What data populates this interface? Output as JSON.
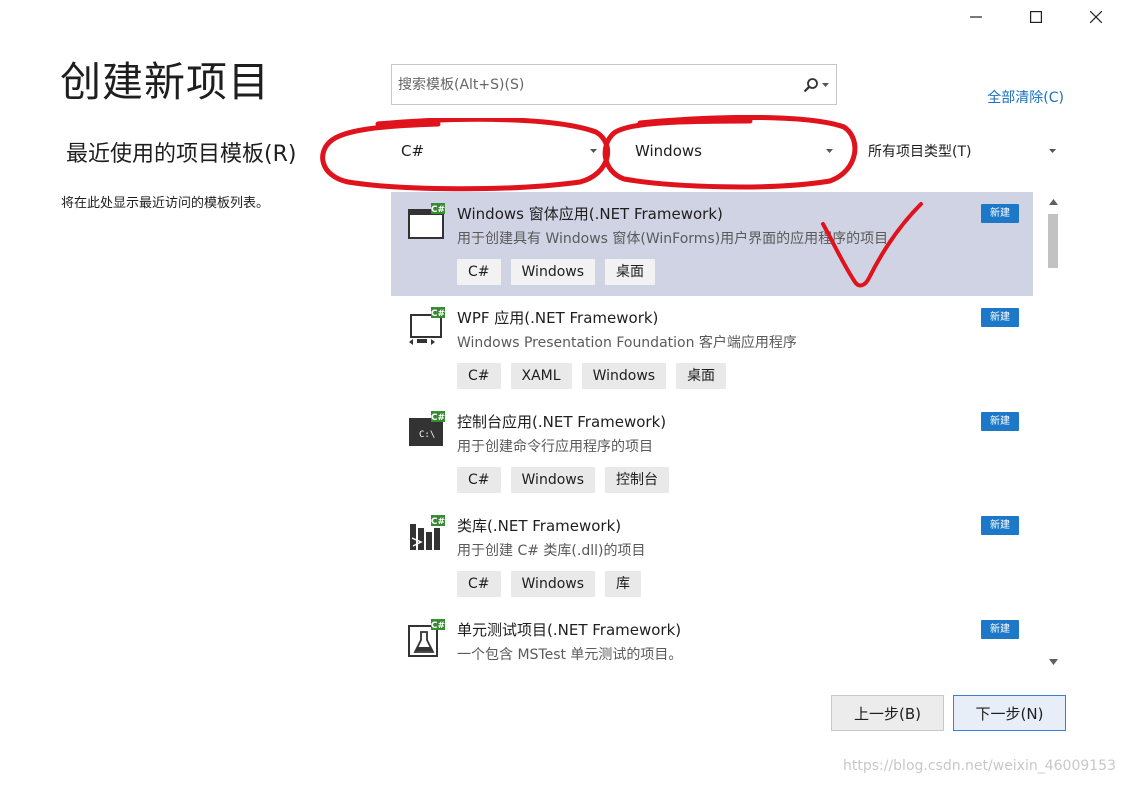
{
  "window": {
    "minimize": "minimize",
    "maximize": "maximize",
    "close": "close"
  },
  "page_title": "创建新项目",
  "recent": {
    "title": "最近使用的项目模板(R)",
    "empty_text": "将在此处显示最近访问的模板列表。"
  },
  "search": {
    "placeholder": "搜索模板(Alt+S)(S)"
  },
  "clear_all": "全部清除(C)",
  "filters": {
    "language": "C#",
    "platform": "Windows",
    "project_type": "所有项目类型(T)"
  },
  "templates": [
    {
      "title": "Windows 窗体应用(.NET Framework)",
      "desc": "用于创建具有 Windows 窗体(WinForms)用户界面的应用程序的项目",
      "tags": [
        "C#",
        "Windows",
        "桌面"
      ],
      "badge": "新建",
      "icon": "winforms-app-icon",
      "selected": true
    },
    {
      "title": "WPF 应用(.NET Framework)",
      "desc": "Windows Presentation Foundation 客户端应用程序",
      "tags": [
        "C#",
        "XAML",
        "Windows",
        "桌面"
      ],
      "badge": "新建",
      "icon": "wpf-app-icon",
      "selected": false
    },
    {
      "title": "控制台应用(.NET Framework)",
      "desc": "用于创建命令行应用程序的项目",
      "tags": [
        "C#",
        "Windows",
        "控制台"
      ],
      "badge": "新建",
      "icon": "console-app-icon",
      "selected": false
    },
    {
      "title": "类库(.NET Framework)",
      "desc": "用于创建 C# 类库(.dll)的项目",
      "tags": [
        "C#",
        "Windows",
        "库"
      ],
      "badge": "新建",
      "icon": "class-library-icon",
      "selected": false
    },
    {
      "title": "单元测试项目(.NET Framework)",
      "desc": "一个包含 MSTest 单元测试的项目。",
      "tags": [],
      "badge": "新建",
      "icon": "unit-test-icon",
      "selected": false
    }
  ],
  "buttons": {
    "back": "上一步(B)",
    "next": "下一步(N)"
  },
  "watermark": "https://blog.csdn.net/weixin_46009153",
  "colors": {
    "accent": "#1e78c8",
    "selected_bg": "#cfd3e3",
    "annotation_red": "#e0121c",
    "link": "#1a6fc4"
  }
}
